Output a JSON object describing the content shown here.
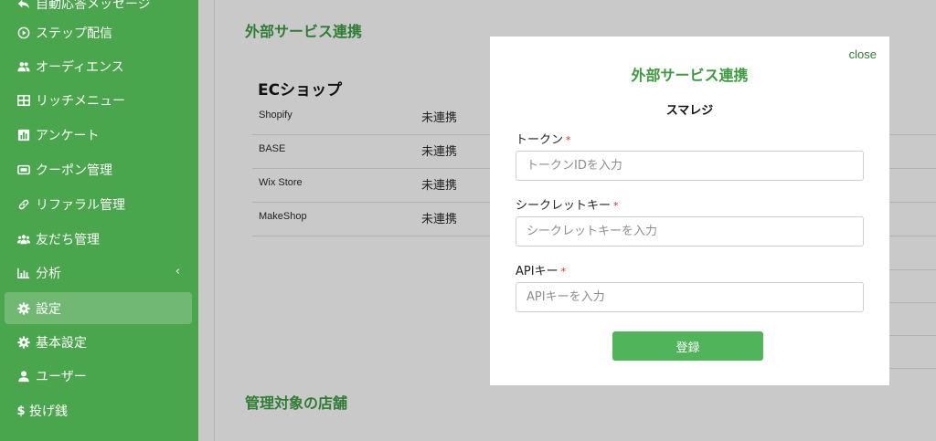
{
  "sidebar": {
    "items": [
      {
        "label": "自動応答メッセージ",
        "icon": "reply-icon"
      },
      {
        "label": "ステップ配信",
        "icon": "play-circle-icon"
      },
      {
        "label": "オーディエンス",
        "icon": "users-icon"
      },
      {
        "label": "リッチメニュー",
        "icon": "grid-icon"
      },
      {
        "label": "アンケート",
        "icon": "poll-icon"
      },
      {
        "label": "クーポン管理",
        "icon": "ticket-icon"
      },
      {
        "label": "リファラル管理",
        "icon": "link-icon"
      },
      {
        "label": "友だち管理",
        "icon": "friends-icon"
      },
      {
        "label": "分析",
        "icon": "chart-icon",
        "chevron": "‹"
      },
      {
        "label": "設定",
        "icon": "gear-icon"
      },
      {
        "label": "基本設定",
        "icon": "gear-icon"
      },
      {
        "label": "ユーザー",
        "icon": "user-icon"
      },
      {
        "label": "投げ銭",
        "icon": "dollar-icon"
      }
    ]
  },
  "main": {
    "section_title": "外部サービス連携",
    "ec_heading": "ECショップ",
    "ec_shops": [
      {
        "name": "Shopify",
        "status": "未連携"
      },
      {
        "name": "BASE",
        "status": "未連携"
      },
      {
        "name": "Wix Store",
        "status": "未連携"
      },
      {
        "name": "MakeShop",
        "status": "未連携"
      }
    ],
    "stores_title": "管理対象の店舗"
  },
  "modal": {
    "close_label": "close",
    "title": "外部サービス連携",
    "subtitle": "スマレジ",
    "fields": [
      {
        "label": "トークン",
        "required_mark": "*",
        "placeholder": "トークンIDを入力",
        "value": ""
      },
      {
        "label": "シークレットキー",
        "required_mark": "*",
        "placeholder": "シークレットキーを入力",
        "value": ""
      },
      {
        "label": "APIキー",
        "required_mark": "*",
        "placeholder": "APIキーを入力",
        "value": ""
      }
    ],
    "submit_label": "登録"
  },
  "colors": {
    "sidebar_bg": "#4aa64c",
    "accent_green": "#3c9a3f",
    "button_green": "#4fb45a",
    "required_red": "#d32f2f",
    "overlay_gray": "#c9c9c9"
  }
}
